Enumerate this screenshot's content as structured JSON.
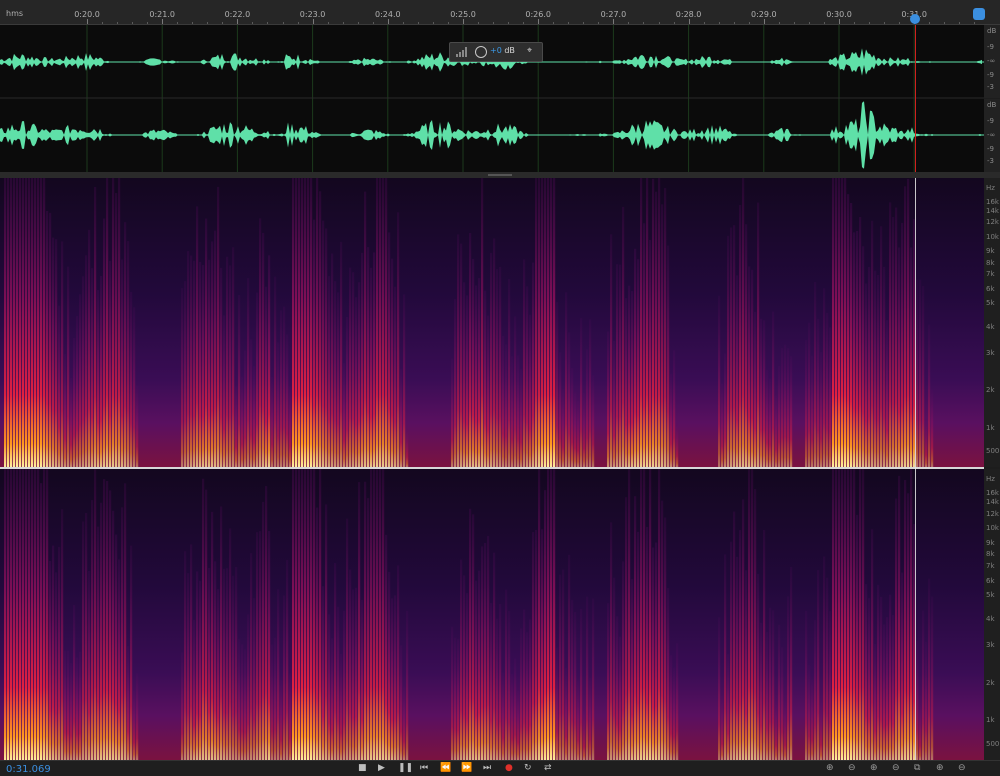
{
  "ruler": {
    "unit_label": "hms",
    "ticks": [
      "0:20.0",
      "0:21.0",
      "0:22.0",
      "0:23.0",
      "0:24.0",
      "0:25.0",
      "0:26.0",
      "0:27.0",
      "0:28.0",
      "0:29.0",
      "0:30.0",
      "0:31.0"
    ]
  },
  "waveform": {
    "db_scale": [
      "dB",
      "-9",
      "-∞",
      "-9",
      "-3"
    ],
    "db_scale_lower": [
      "dB",
      "-9",
      "-∞",
      "-9",
      "-3"
    ]
  },
  "hud": {
    "gain_prefix": "+0",
    "gain_unit": " dB"
  },
  "spectrogram": {
    "hz_labels": [
      "Hz",
      "16k",
      "14k",
      "12k",
      "10k",
      "9k",
      "8k",
      "7k",
      "6k",
      "5k",
      "4k",
      "3k",
      "2k",
      "1k",
      "500"
    ]
  },
  "transport": {
    "time": "0:31.069",
    "buttons": [
      "stop-icon",
      "play-icon",
      "pause-icon",
      "go-to-start-icon",
      "rewind-icon",
      "fast-forward-icon",
      "go-to-end-icon",
      "record-icon",
      "loop-icon",
      "skip-selection-icon"
    ],
    "zoom_buttons": [
      "zoom-in-amplitude-icon",
      "zoom-out-amplitude-icon",
      "zoom-in-time-icon",
      "zoom-out-time-icon",
      "zoom-full-icon",
      "zoom-in-selection-icon",
      "zoom-out-full-icon"
    ]
  },
  "colors": {
    "accent": "#3b8fe0",
    "waveform": "#5fe0a8",
    "cursor": "#d02020"
  }
}
